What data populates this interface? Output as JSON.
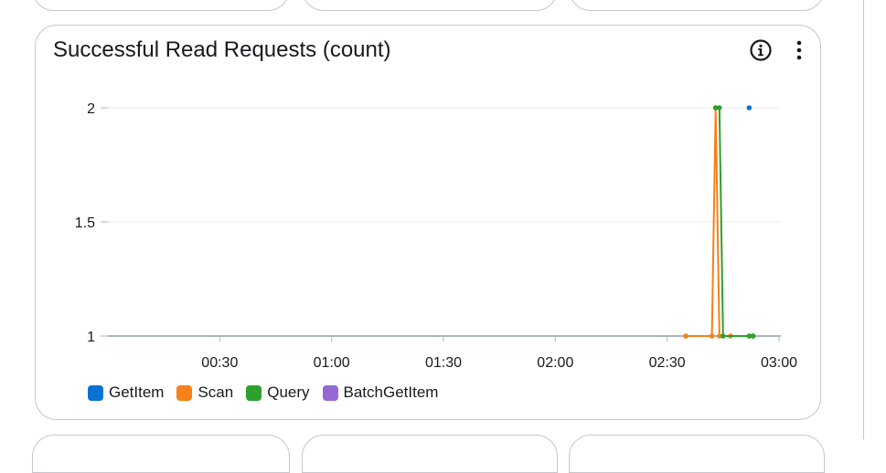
{
  "card": {
    "title": "Successful Read Requests (count)",
    "info_icon": "info-icon",
    "more_icon": "more-vertical-icon"
  },
  "chart_data": {
    "type": "line",
    "title": "Successful Read Requests (count)",
    "xlabel": "",
    "ylabel": "",
    "x_ticks": [
      "00:30",
      "01:00",
      "01:30",
      "02:00",
      "02:30",
      "03:00"
    ],
    "y_ticks": [
      "1",
      "1.5",
      "2"
    ],
    "xlim": [
      "00:00",
      "03:00"
    ],
    "ylim": [
      1,
      2
    ],
    "grid": true,
    "legend_position": "bottom-left",
    "series": [
      {
        "name": "GetItem",
        "color": "#0972d3",
        "points": [
          {
            "x": "02:52",
            "y": 2
          },
          {
            "x": "02:53",
            "y": 1
          }
        ],
        "connected": false
      },
      {
        "name": "Scan",
        "color": "#f5811b",
        "points": [
          {
            "x": "02:35",
            "y": 1
          },
          {
            "x": "02:42",
            "y": 1
          },
          {
            "x": "02:43",
            "y": 2
          },
          {
            "x": "02:44",
            "y": 1
          },
          {
            "x": "02:47",
            "y": 1
          },
          {
            "x": "02:52",
            "y": 1
          }
        ],
        "connected": true
      },
      {
        "name": "Query",
        "color": "#2ea02e",
        "points": [
          {
            "x": "02:43",
            "y": 2
          },
          {
            "x": "02:44",
            "y": 2
          },
          {
            "x": "02:45",
            "y": 1
          },
          {
            "x": "02:52",
            "y": 1
          },
          {
            "x": "02:53",
            "y": 1
          }
        ],
        "connected": true
      },
      {
        "name": "BatchGetItem",
        "color": "#9469d6",
        "points": [],
        "connected": false
      }
    ]
  }
}
